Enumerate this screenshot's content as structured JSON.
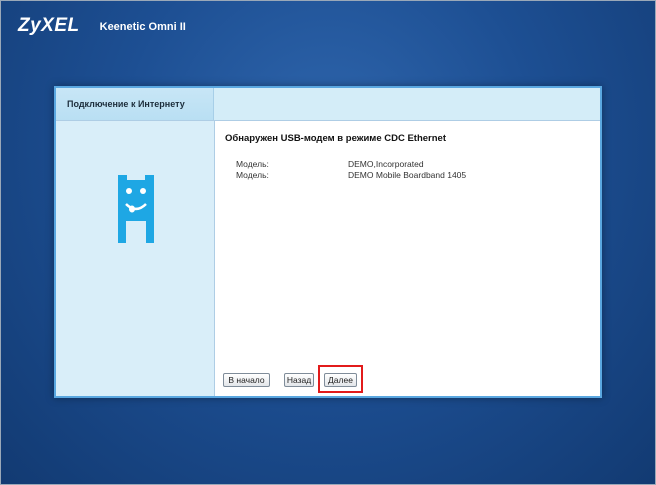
{
  "header": {
    "brand": "ZyXEL",
    "product": "Keenetic Omni II"
  },
  "panel": {
    "tab_label": "Подключение к Интернету",
    "title": "Обнаружен USB-модем в режиме CDC Ethernet",
    "info": [
      {
        "label": "Модель:",
        "value": "DEMO,Incorporated"
      },
      {
        "label": "Модель:",
        "value": "DEMO Mobile Boardband 1405"
      }
    ],
    "buttons": {
      "start": "В начало",
      "back": "Назад",
      "next": "Далее"
    }
  },
  "colors": {
    "accent": "#1ea7e4",
    "highlight": "#e21b1b",
    "panel_border": "#5aa7e0"
  }
}
